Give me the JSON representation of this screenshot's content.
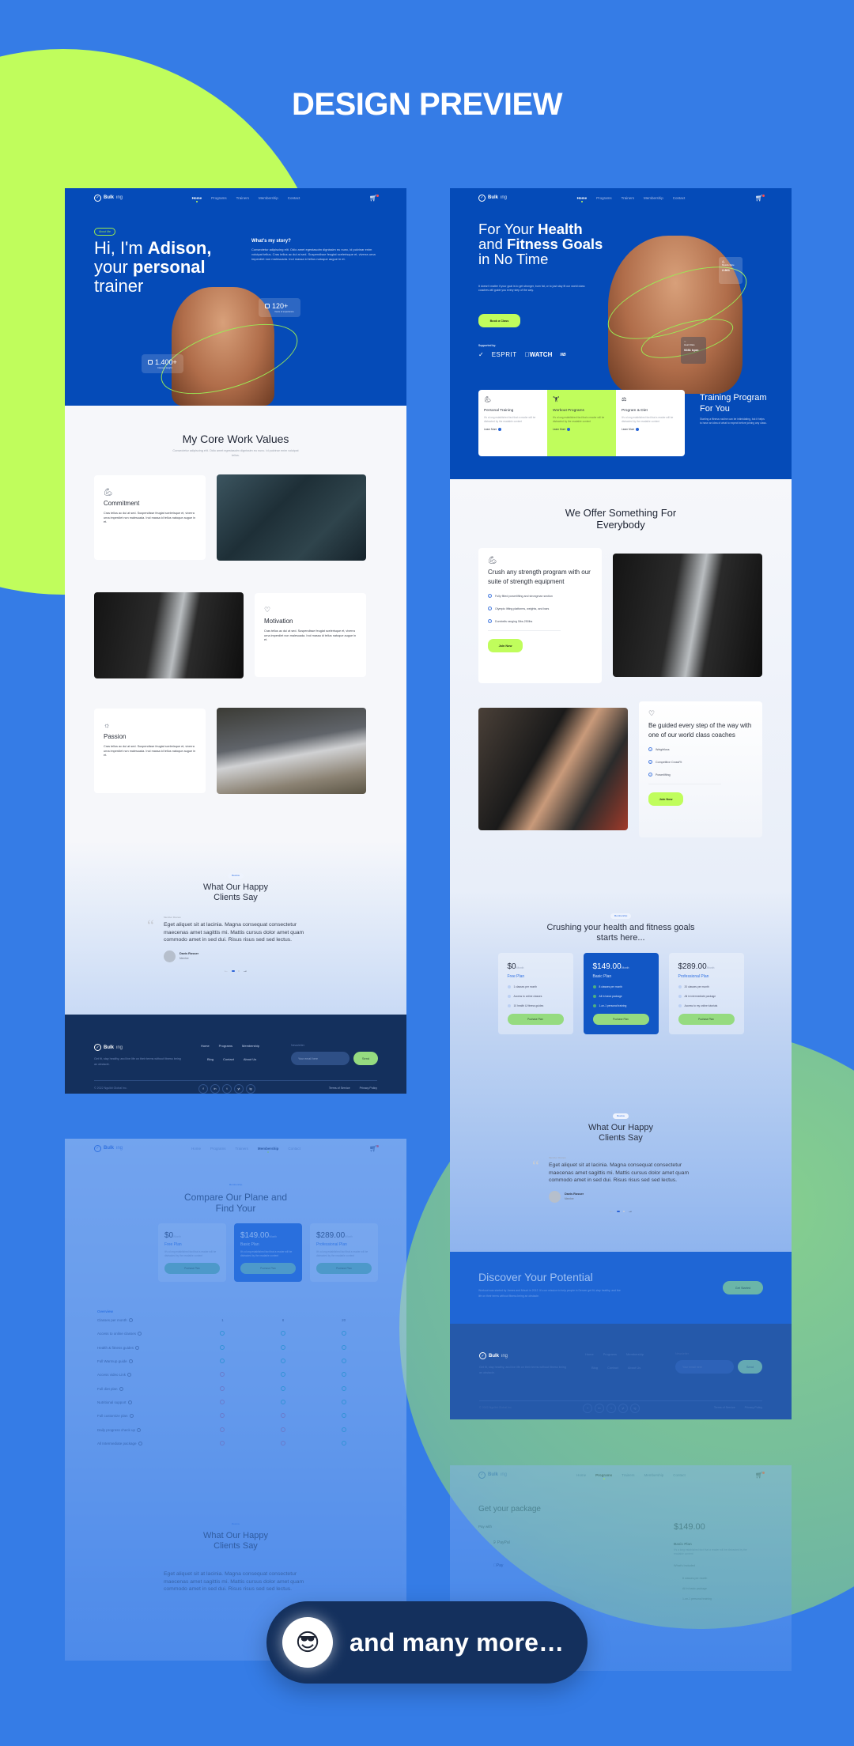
{
  "headline": "DESIGN PREVIEW",
  "brand": {
    "name_bold": "Bulk",
    "name_light": "ing"
  },
  "colors": {
    "background": "#357ce6",
    "lime": "#c0fd5c",
    "brand_blue": "#054bb8",
    "footer": "#14305d",
    "green_button": "#95db80"
  },
  "nav": {
    "links": [
      "Home",
      "Programs",
      "Trainers",
      "Membership",
      "Contact"
    ]
  },
  "about_page": {
    "badge": "About Me",
    "title_pre": "Hi, I'm ",
    "title_bold1": "Adison,",
    "title_mid": "your ",
    "title_bold2": "personal",
    "title_end": "trainer",
    "story_title": "What's my story?",
    "story_text": "Consectetur adipiscing elit. Odio amet egestasolm dignissim eu nunc, id pulvinar enim volutpat tellus. Cras tellus ac dui at sed. Suspendisse feugiat scelerisque et, viverra urna imperdiet non malesuada. Inol massa id tellus natoque augue in et.",
    "stats": [
      {
        "value": "120+",
        "label": "Years of experience"
      },
      {
        "value": "1.400+",
        "label": "Classes taught"
      }
    ],
    "values_title": "My Core Work Values",
    "values_sub": "Consectetur adipiscing elit. Odio amet egestasolm dignissim eu nunc. Id pulvinar enim volutpat tellus.",
    "values": [
      {
        "icon": "flexed-arm-icon",
        "title": "Commitment",
        "text": "Cras tellus ac dui at sed. Suspendisse feugiat scelerisque et, viverra urna imperdiet non malesuada. Inol massa id tellus natoque augue in et."
      },
      {
        "icon": "heart-check-icon",
        "title": "Motivation",
        "text": "Cras tellus ac dui at sed. Suspendisse feugiat scelerisque et, viverra urna imperdiet non malesuada. Inol massa id tellus natoque augue in et."
      },
      {
        "icon": "lightbulb-icon",
        "title": "Passion",
        "text": "Cras tellus ac dui at sed. Suspendisse feugiat scelerisque et, viverra urna imperdiet non malesuada. Inol massa id tellus natoque augue in et."
      }
    ]
  },
  "review": {
    "pill": "Review",
    "title_line1": "What Our Happy",
    "title_line2": "Clients Say",
    "label": "Member Review",
    "text": "Eget aliquet sit at lacinia. Magna consequat consectetur maecenas amet sagittis mi. Mattis cursus dolor amet quam commodo amet in sed dui. Risus risus sed sed lectus.",
    "author": "Davis Rosser",
    "role": "Member"
  },
  "footer": {
    "tagline": "Get fit, stay healthy, and live life on their terms without fitness being an obstacle.",
    "links_row1": [
      "Home",
      "Programs",
      "Membership"
    ],
    "links_row2": [
      "Blog",
      "Contact",
      "About Us"
    ],
    "newsletter_label": "Newsletter",
    "email_placeholder": "Your email here",
    "send": "Send",
    "copyright": "© 2022 Ngulkit Global Inc.",
    "social": [
      "f",
      "in",
      "t",
      "yt",
      "ig"
    ],
    "terms": "Terms of Service",
    "privacy": "Privacy Policy"
  },
  "home_page": {
    "title_a": "For Your ",
    "title_b": "Health",
    "title_c": "and ",
    "title_d": "Fitness Goals",
    "title_e": "in No Time",
    "lead": "It doesn't matter if your goal is to get stronger, burn fat, or to just stay fit our world class coaches will guide you every step of the way.",
    "cta": "Book a Class",
    "supported_by": "Supported by:",
    "sponsors": [
      "Nike",
      "ESPRIT",
      "WATCH",
      "New Balance"
    ],
    "muscle_label": "Muscle Rate",
    "muscle_value": "2.861",
    "heart_label": "Heart Rate",
    "heart_value": "9281 bpm",
    "services": [
      {
        "title": "Personal Training",
        "text": "It's a long established fact that a reader will be distracted by the readable content",
        "link": "Learn More"
      },
      {
        "title": "Workout Programs",
        "text": "It's a long established fact that a reader will be distracted by the readable content",
        "link": "Learn More"
      },
      {
        "title": "Program & Diet",
        "text": "It's a long established fact that a reader will be distracted by the readable content",
        "link": "Learn More"
      }
    ],
    "training_title": "Training Program For You",
    "training_text": "Starting a fitness routine can be intimidating, but it helps to have an idea of what to expect before joining any class.",
    "offer_title_line1": "We Offer Something For",
    "offer_title_line2": "Everybody",
    "offers": [
      {
        "title": "Crush any strength program with our suite of strength equipment",
        "items": [
          "Fully fitted powerlifting and strongman section",
          "Olympic lifting platforms, weights, and bars",
          "Dumbells ranging 5lbs-250lbs"
        ],
        "button": "Join Now"
      },
      {
        "title": "Be guided every step of the way with one of our world class coaches",
        "items": [
          "Weightloss",
          "Competitive CrossFit",
          "Powerlifting"
        ],
        "button": "Join Now"
      }
    ],
    "membership_pill": "Membership",
    "pricing_title_line1": "Crushing your health and fitness goals",
    "pricing_title_line2": "starts here...",
    "plans": [
      {
        "price": "$0",
        "period": "/Month",
        "name": "Free Plan",
        "features": [
          "1 classes per month",
          "Access to online classes",
          "10 health & fitness guides"
        ],
        "button": "Puchase Plan"
      },
      {
        "price": "$149.00",
        "period": "/Month",
        "name": "Basic Plan",
        "features": [
          "8 classes per month",
          "All in basic package",
          "1-on-1 personal training"
        ],
        "button": "Puchase Plan"
      },
      {
        "price": "$289.00",
        "period": "/Month",
        "name": "Professional Plan",
        "features": [
          "20 classes per month",
          "All in intermediate package",
          "Access to my online tutorials"
        ],
        "button": "Puchase Plan"
      }
    ],
    "cta_title": "Discover Your Potential",
    "cta_text": "Workout was started by James and Mount in 2012. It's our mission to help people in Denver get fit, stay healthy, and live life on their terms without fitness being an obstacle.",
    "cta_button": "Get Started"
  },
  "membership_page": {
    "pill": "Membership",
    "title_line1": "Compare Our Plane and",
    "title_line2": "Find Your",
    "plan_desc": "It's a long established fact that a reader will be distracted by the readable content",
    "overview_label": "Overview",
    "rows": [
      {
        "feature": "Classes per month",
        "free": "1",
        "basic": "8",
        "pro": "20"
      },
      {
        "feature": "Access to online classes",
        "free": "yes",
        "basic": "yes",
        "pro": "yes"
      },
      {
        "feature": "Health & fitness guides",
        "free": "yes",
        "basic": "yes",
        "pro": "yes"
      },
      {
        "feature": "Full Warmup guide",
        "free": "yes",
        "basic": "yes",
        "pro": "yes"
      },
      {
        "feature": "Access video Link",
        "free": "no",
        "basic": "yes",
        "pro": "yes"
      },
      {
        "feature": "Full diet plan",
        "free": "no",
        "basic": "yes",
        "pro": "yes"
      },
      {
        "feature": "Nutritional support",
        "free": "no",
        "basic": "yes",
        "pro": "yes"
      },
      {
        "feature": "Full customize plan",
        "free": "no",
        "basic": "no",
        "pro": "yes"
      },
      {
        "feature": "Daily progress check up",
        "free": "no",
        "basic": "no",
        "pro": "yes"
      },
      {
        "feature": "All Intermediate package",
        "free": "no",
        "basic": "no",
        "pro": "yes"
      }
    ]
  },
  "checkout_page": {
    "title": "Get your package",
    "pay_with": "Pay with",
    "methods": [
      "PayPal",
      "Pay"
    ],
    "price": "$149.00",
    "plan": "Basic Plan",
    "plan_desc": "It's a long established fact that a reader will be distracted by the readable content",
    "included_label": "What's Included",
    "included": [
      "8 classes per month",
      "All in basic package",
      "1-on-1 personal training"
    ]
  },
  "more_badge": {
    "emoji": "😎",
    "text": "and many more…"
  }
}
